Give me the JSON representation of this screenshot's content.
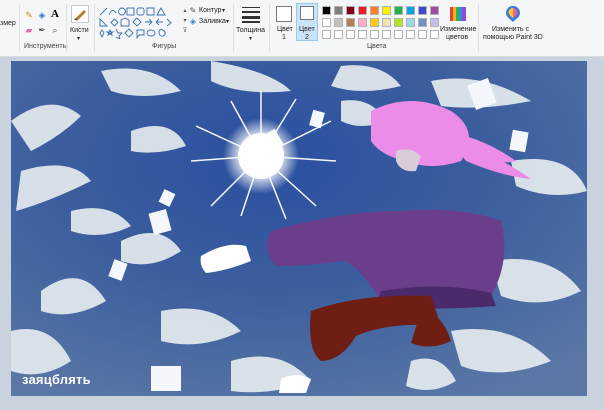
{
  "ribbon": {
    "resize_label": "змер",
    "groups": {
      "tools": "Инструменты",
      "shapes": "Фигуры",
      "colors": "Цвета"
    },
    "brushes_label": "Кисти",
    "outline_label": "Контур",
    "fill_label": "Заливка",
    "thickness_label": "Толщина",
    "color1_label": "Цвет 1",
    "color1_line1": "Цвет",
    "color1_line2": "1",
    "color2_line1": "Цвет",
    "color2_line2": "2",
    "edit_colors_line1": "Изменение",
    "edit_colors_line2": "цветов",
    "paint3d_line1": "Изменить с",
    "paint3d_line2": "помощью Paint 3D",
    "palette_row1": [
      "#000000",
      "#7f7f7f",
      "#880015",
      "#ed1c24",
      "#ff7f27",
      "#fff200",
      "#22b14c",
      "#00a2e8",
      "#3f48cc",
      "#a349a4"
    ],
    "palette_row2": [
      "#ffffff",
      "#c3c3c3",
      "#b97a57",
      "#ffaec9",
      "#ffc90e",
      "#efe4b0",
      "#b5e61d",
      "#99d9ea",
      "#7092be",
      "#c8bfe7"
    ],
    "palette_row3": [
      "#ffffff",
      "#ffffff",
      "#ffffff",
      "#ffffff",
      "#ffffff",
      "#ffffff",
      "#ffffff",
      "#ffffff",
      "#ffffff",
      "#ffffff"
    ]
  },
  "canvas": {
    "watermark": "заяцблять"
  }
}
